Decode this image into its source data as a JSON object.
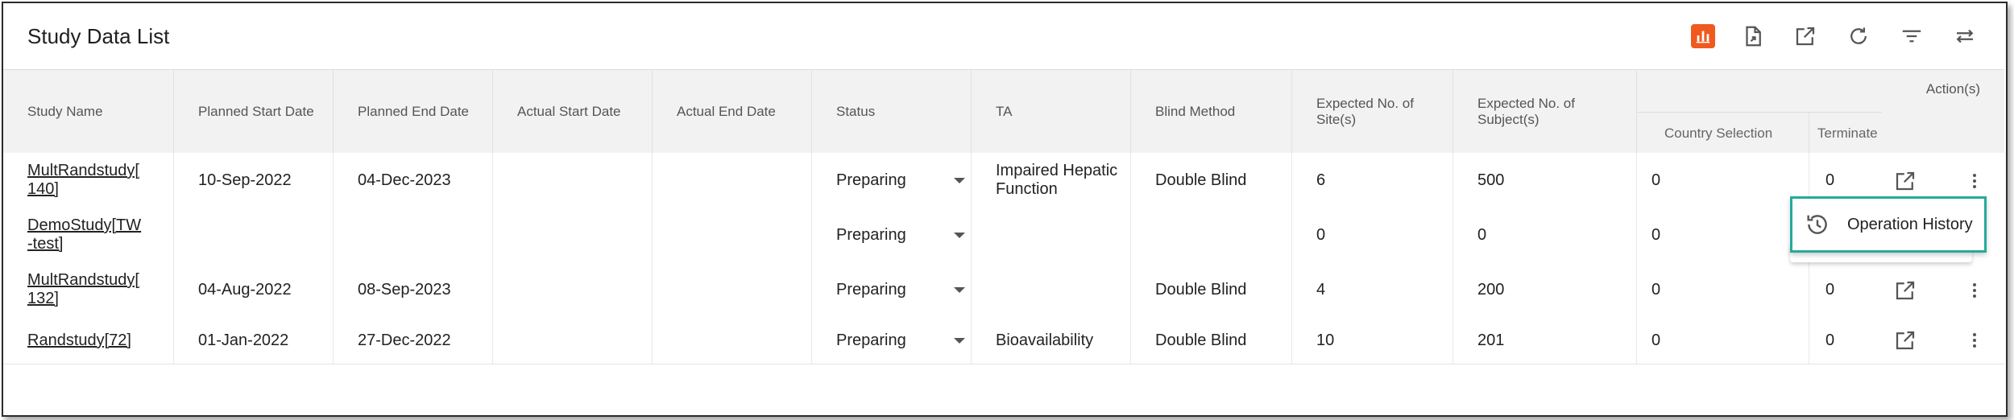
{
  "page": {
    "title": "Study Data List"
  },
  "colors": {
    "accent": "#f05a1e",
    "popup_border": "#27a99b",
    "header_bg": "#f2f2f2"
  },
  "toolbar": [
    {
      "name": "chart-view",
      "icon": "bar-chart-icon",
      "active": true
    },
    {
      "name": "export",
      "icon": "file-export-icon"
    },
    {
      "name": "open-external",
      "icon": "open-in-new-icon"
    },
    {
      "name": "refresh",
      "icon": "refresh-icon"
    },
    {
      "name": "filter",
      "icon": "filter-icon"
    },
    {
      "name": "swap",
      "icon": "swap-horizontal-icon"
    }
  ],
  "table": {
    "columns": [
      "Study Name",
      "Planned Start Date",
      "Planned End Date",
      "Actual Start Date",
      "Actual End Date",
      "Status",
      "TA",
      "Blind Method",
      "Expected No. of Site(s)",
      "Expected No. of Subject(s)"
    ],
    "sub_columns": [
      "Country Selection",
      "Terminate"
    ],
    "actions_label": "Action(s)",
    "rows": [
      {
        "study_name": [
          "MultRandstudy[",
          "140]"
        ],
        "planned_start": "10-Sep-2022",
        "planned_end": "04-Dec-2023",
        "actual_start": "",
        "actual_end": "",
        "status": "Preparing",
        "ta": [
          "Impaired Hepatic",
          "Function"
        ],
        "blind": "Double Blind",
        "sites": "6",
        "subjects": "500",
        "country": "0",
        "terminate": "0"
      },
      {
        "study_name": [
          "DemoStudy[TW",
          "-test]"
        ],
        "planned_start": "",
        "planned_end": "",
        "actual_start": "",
        "actual_end": "",
        "status": "Preparing",
        "ta": [
          "",
          ""
        ],
        "blind": "",
        "sites": "0",
        "subjects": "0",
        "country": "0",
        "terminate": ""
      },
      {
        "study_name": [
          "MultRandstudy[",
          "132]"
        ],
        "planned_start": "04-Aug-2022",
        "planned_end": "08-Sep-2023",
        "actual_start": "",
        "actual_end": "",
        "status": "Preparing",
        "ta": [
          "",
          ""
        ],
        "blind": "Double Blind",
        "sites": "4",
        "subjects": "200",
        "country": "0",
        "terminate": "0"
      },
      {
        "study_name": [
          "Randstudy[72]",
          ""
        ],
        "planned_start": "01-Jan-2022",
        "planned_end": "27-Dec-2022",
        "actual_start": "",
        "actual_end": "",
        "status": "Preparing",
        "ta": [
          "Bioavailability",
          ""
        ],
        "blind": "Double Blind",
        "sites": "10",
        "subjects": "201",
        "country": "0",
        "terminate": "0"
      }
    ]
  },
  "popup_menu": {
    "items": [
      {
        "label": "Operation History",
        "icon": "history-icon"
      }
    ]
  }
}
